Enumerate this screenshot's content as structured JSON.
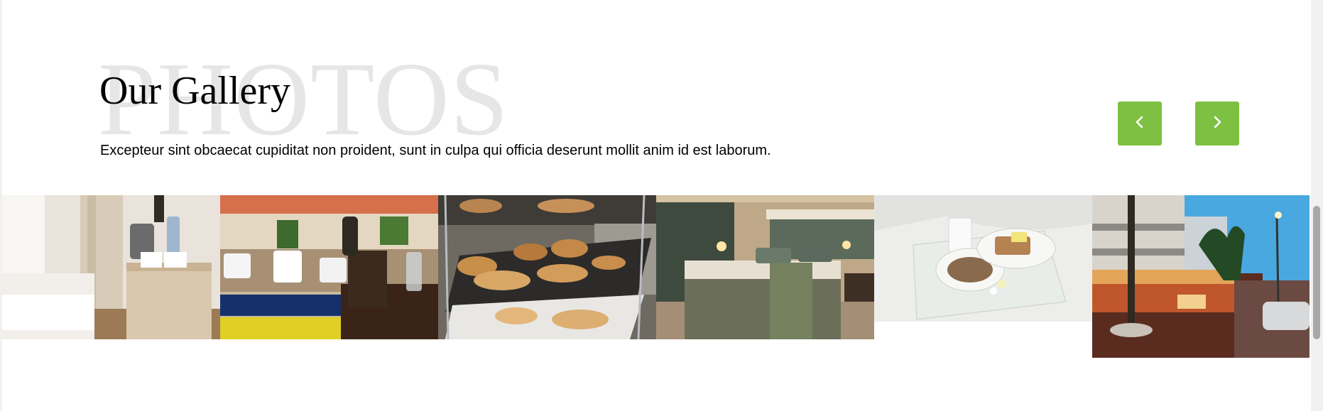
{
  "section": {
    "background_word": "PHOTOS",
    "title": "Our Gallery",
    "description": "Excepteur sint obcaecat cupiditat non proident, sunt in culpa qui officia deserunt mollit anim id est laborum."
  },
  "carousel": {
    "prev_icon": "chevron-left-icon",
    "next_icon": "chevron-right-icon",
    "accent_color": "#7dc042"
  },
  "photos": [
    {
      "name": "photo-room-kettle"
    },
    {
      "name": "photo-terrace-champagne"
    },
    {
      "name": "photo-pastry-stand"
    },
    {
      "name": "photo-hotel-bedroom"
    },
    {
      "name": "photo-breakfast-tray"
    },
    {
      "name": "photo-street-night-cafe"
    }
  ]
}
